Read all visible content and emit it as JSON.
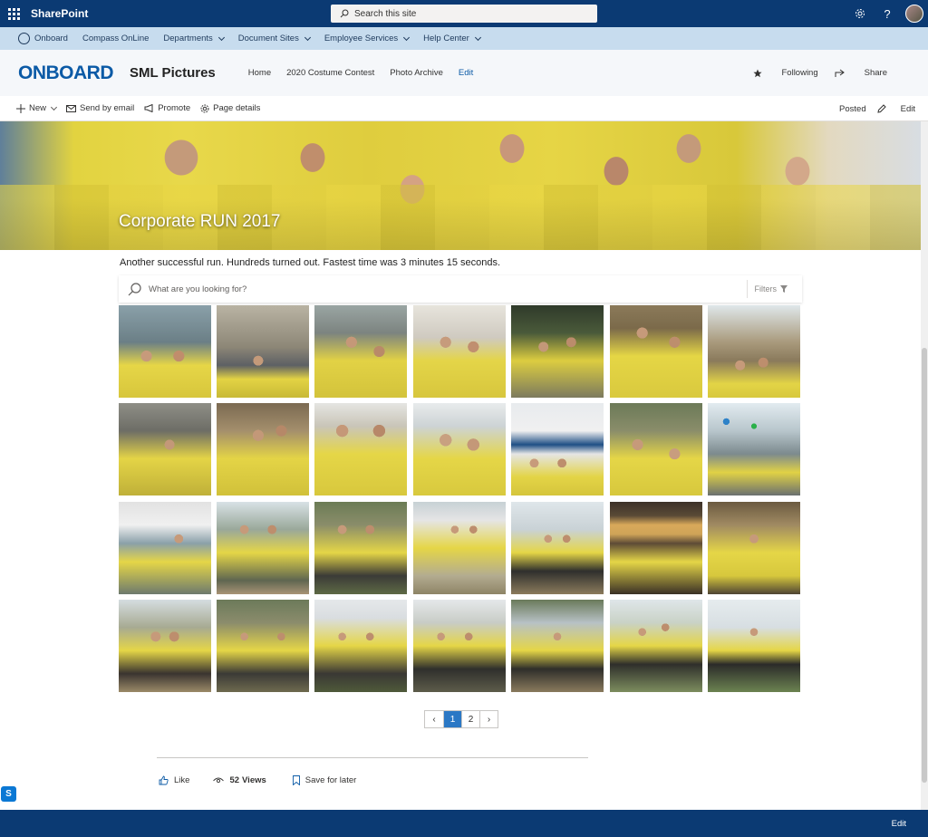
{
  "suitebar": {
    "app_name": "SharePoint",
    "search_placeholder": "Search this site",
    "settings_icon": "gear-icon",
    "help_label": "?"
  },
  "hubnav": {
    "items": [
      {
        "label": "Onboard"
      },
      {
        "label": "Compass OnLine"
      },
      {
        "label": "Departments"
      },
      {
        "label": "Document Sites"
      },
      {
        "label": "Employee Services"
      },
      {
        "label": "Help Center"
      }
    ]
  },
  "site": {
    "logo_left": "ON",
    "logo_right": "BOARD",
    "title": "SML Pictures",
    "nav": [
      {
        "label": "Home"
      },
      {
        "label": "2020 Costume Contest"
      },
      {
        "label": "Photo Archive"
      },
      {
        "label": "Edit"
      }
    ],
    "following_label": "Following",
    "share_label": "Share"
  },
  "commandbar": {
    "new_label": "New",
    "send_email_label": "Send by email",
    "promote_label": "Promote",
    "page_details_label": "Page details",
    "posted_label": "Posted",
    "edit_label": "Edit"
  },
  "page": {
    "hero_title": "Corporate RUN 2017",
    "description": "Another successful run. Hundreds turned out. Fastest time was 3 minutes 15 seconds.",
    "gallery_search_placeholder": "What are you looking for?",
    "filters_label": "Filters"
  },
  "pager": {
    "prev": "‹",
    "pages": [
      "1",
      "2"
    ],
    "current": "1",
    "next": "›"
  },
  "social": {
    "like_label": "Like",
    "views_count": "52",
    "views_label": "Views",
    "save_label": "Save for later"
  },
  "footer": {
    "edit_label": "Edit"
  },
  "colors": {
    "suitebar": "#0b3a73",
    "hubnav": "#c7dcee",
    "accent": "#0b5aa6",
    "pager_current": "#2b78c5"
  }
}
